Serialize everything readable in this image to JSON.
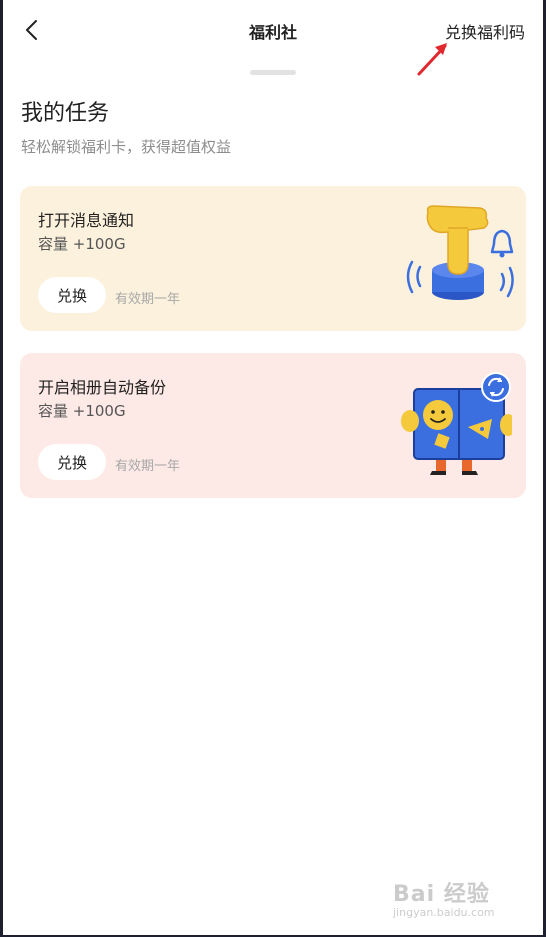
{
  "header": {
    "title": "福利社",
    "redeem_code_label": "兑换福利码"
  },
  "section": {
    "title": "我的任务",
    "subtitle": "轻松解锁福利卡，获得超值权益"
  },
  "tasks": [
    {
      "name": "打开消息通知",
      "reward": "容量 +100G",
      "button_label": "兑换",
      "validity": "有效期一年",
      "background": "#fbf1dc",
      "illustration": "hand-press-button-icon"
    },
    {
      "name": "开启相册自动备份",
      "reward": "容量 +100G",
      "button_label": "兑换",
      "validity": "有效期一年",
      "background": "#fde9e5",
      "illustration": "photo-album-sync-icon"
    }
  ],
  "watermark": {
    "brand": "Bai 经验",
    "url": "jingyan.baidu.com"
  },
  "colors": {
    "annotation_arrow": "#e0282e",
    "accent_blue": "#3b6fe0",
    "accent_yellow": "#f5c93c"
  }
}
